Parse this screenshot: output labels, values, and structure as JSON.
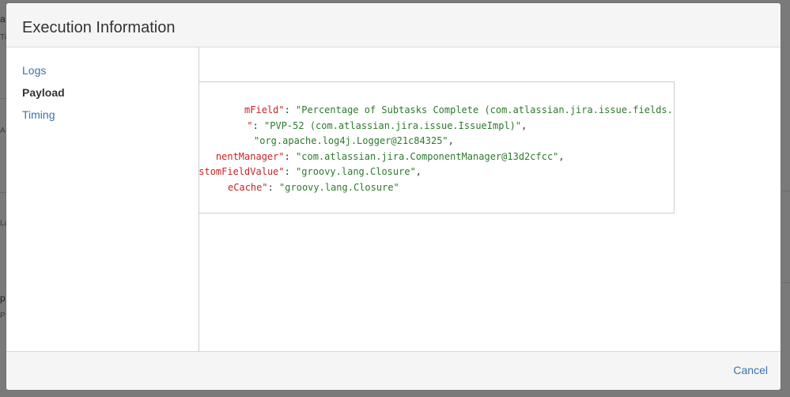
{
  "background": {
    "fragments": [
      "a",
      "Ti",
      "A",
      "La",
      "p",
      "P"
    ]
  },
  "dialog": {
    "title": "Execution Information",
    "nav": [
      {
        "label": "Logs",
        "active": false
      },
      {
        "label": "Payload",
        "active": true
      },
      {
        "label": "Timing",
        "active": false
      }
    ],
    "payload_lines": [
      {
        "key": "mField\"",
        "sep": ": ",
        "value": "\"Percentage of Subtasks Complete (com.atlassian.jira.issue.fields.ImmutableCustomField)\"",
        "tail": ","
      },
      {
        "key": "\"",
        "sep": ": ",
        "value": "\"PVP-52 (com.atlassian.jira.issue.IssueImpl)\"",
        "tail": ","
      },
      {
        "key": "",
        "sep": " ",
        "value": "\"org.apache.log4j.Logger@21c84325\"",
        "tail": ","
      },
      {
        "key": "nentManager\"",
        "sep": ": ",
        "value": "\"com.atlassian.jira.ComponentManager@13d2cfcc\"",
        "tail": ","
      },
      {
        "key": "stomFieldValue\"",
        "sep": ": ",
        "value": "\"groovy.lang.Closure\"",
        "tail": ","
      },
      {
        "key": "eCache\"",
        "sep": ": ",
        "value": "\"groovy.lang.Closure\"",
        "tail": ""
      }
    ],
    "footer": {
      "cancel_label": "Cancel"
    }
  },
  "colors": {
    "json_key": "#cc2222",
    "json_string": "#2c7a2c",
    "link": "#3b73af",
    "overlay": "#7d7d7d"
  }
}
